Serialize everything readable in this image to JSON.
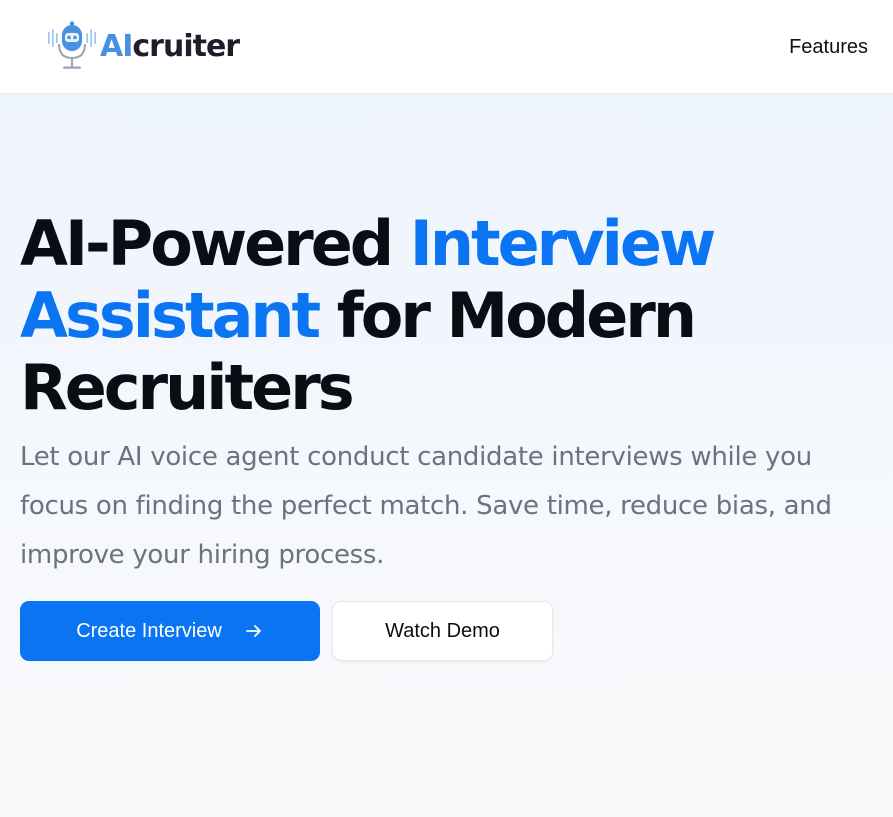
{
  "brand": {
    "name_accent": "AI",
    "name_rest": "cruiter",
    "logo_icon": "microphone-robot-icon"
  },
  "nav": {
    "features_label": "Features"
  },
  "hero": {
    "headline_part1": "AI-Powered ",
    "headline_highlight": "Interview Assistant",
    "headline_part2": " for Modern Recruiters",
    "subtext": "Let our AI voice agent conduct candidate interviews while you focus on finding the perfect match. Save time, reduce bias, and improve your hiring process.",
    "primary_button_label": "Create Interview",
    "primary_button_icon": "arrow-right-icon",
    "secondary_button_label": "Watch Demo"
  },
  "colors": {
    "accent": "#0a74f2",
    "logo_accent": "#4a90e2",
    "headline": "#0b0d14",
    "subtext": "#6b7280"
  }
}
